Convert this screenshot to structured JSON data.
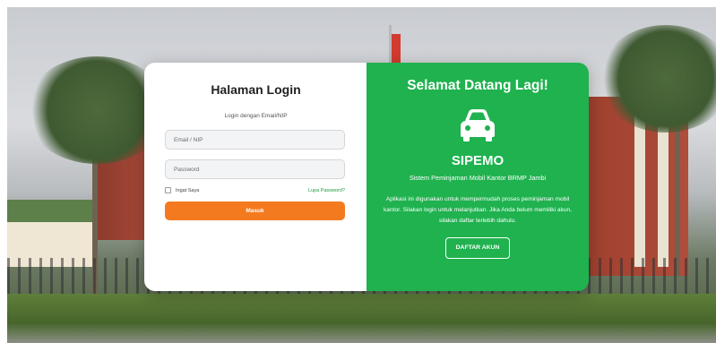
{
  "login": {
    "title": "Halaman Login",
    "subtitle": "Login dengan Email/NIP",
    "email_placeholder": "Email / NIP",
    "password_placeholder": "Password",
    "remember_label": "Ingat Saya",
    "forgot_label": "Lupa Password?",
    "submit_label": "Masuk"
  },
  "welcome": {
    "heading": "Selamat Datang Lagi!",
    "icon": "car-icon",
    "app_name": "SIPEMO",
    "app_full_name": "Sistem Peminjaman Mobil Kantor BRMP Jambi",
    "description": "Aplikasi ini digunakan untuk mempermudah proses peminjaman mobil kantor. Silakan login untuk melanjutkan. Jika Anda belum memiliki akun, silakan daftar terlebih dahulu.",
    "register_label": "DAFTAR AKUN"
  },
  "colors": {
    "accent_orange": "#f47a1f",
    "accent_green": "#1fb24f",
    "link_green": "#1f9a3e"
  }
}
